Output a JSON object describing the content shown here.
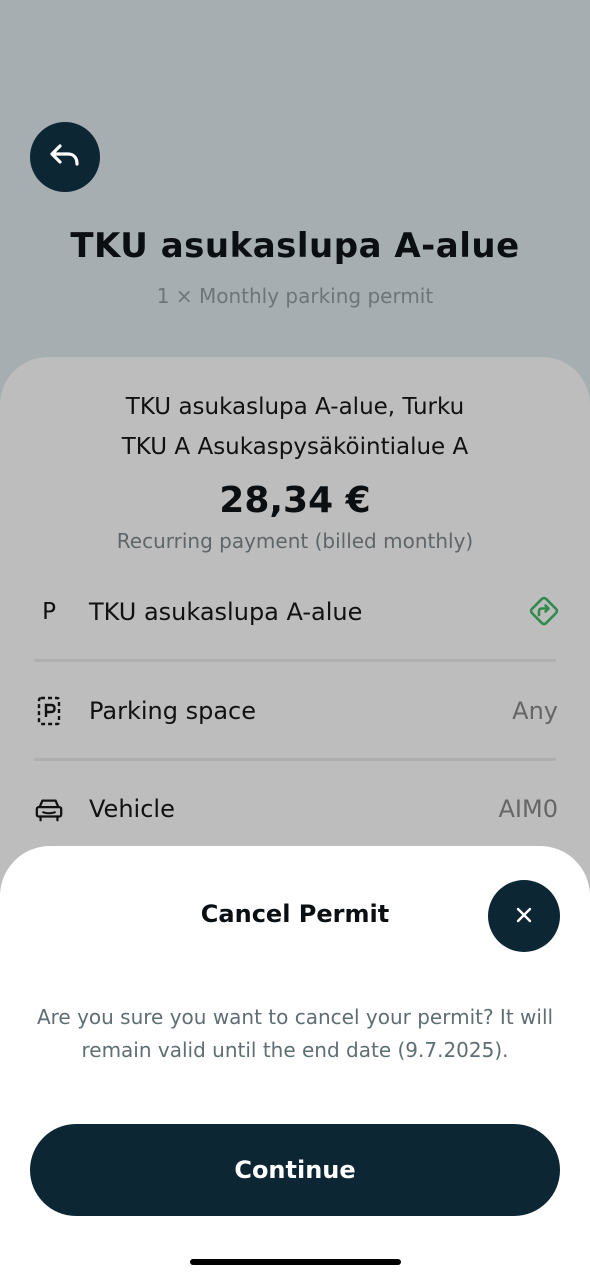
{
  "header": {
    "back_icon": "back-arrow-icon",
    "title": "TKU asukaslupa A-alue",
    "subtitle": "1 × Monthly parking permit"
  },
  "details": {
    "location_line1": "TKU asukaslupa A-alue, Turku",
    "location_line2": "TKU A Asukaspysäköintialue A",
    "price": "28,34 €",
    "payment_note": "Recurring payment (billed monthly)",
    "rows": [
      {
        "icon": "P",
        "label": "TKU asukaslupa A-alue",
        "value": "",
        "action_icon": "directions-icon"
      },
      {
        "icon": "parking-space-icon",
        "label": "Parking space",
        "value": "Any"
      },
      {
        "icon": "car-icon",
        "label": "Vehicle",
        "value": "AIM0"
      }
    ]
  },
  "sheet": {
    "title": "Cancel Permit",
    "close_icon": "close-icon",
    "message": "Are you sure you want to cancel your permit? It will remain valid until the end date (9.7.2025).",
    "continue_label": "Continue"
  },
  "colors": {
    "background_dim": "#a7aeb1",
    "card": "#bdbdbd",
    "primary_dark": "#0d2634",
    "accent_green": "#2f8a4c",
    "sheet": "#ffffff"
  }
}
